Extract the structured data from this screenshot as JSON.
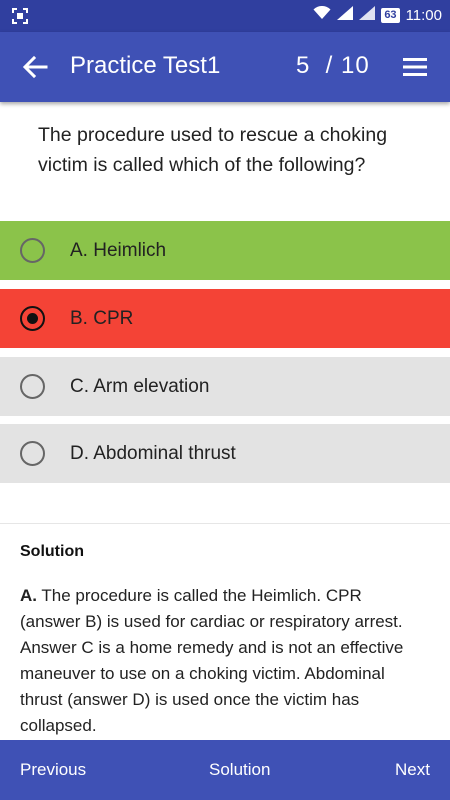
{
  "status_bar": {
    "battery": "63",
    "time": "11:00",
    "icons": [
      "screenshot-icon",
      "wifi-icon",
      "signal-icon",
      "battery-icon"
    ]
  },
  "app_bar": {
    "title": "Practice Test1",
    "progress": "5  / 10",
    "back_icon": "arrow-back-icon",
    "menu_icon": "menu-icon"
  },
  "question": "The procedure used to rescue a choking victim is called which of the following?",
  "options": [
    {
      "label": "A. Heimlich",
      "state": "correct",
      "color": "#8bc34a"
    },
    {
      "label": "B. CPR",
      "state": "selected-wrong",
      "color": "#f44336"
    },
    {
      "label": "C. Arm elevation",
      "state": "neutral",
      "color": "#e3e3e3"
    },
    {
      "label": "D. Abdominal thrust",
      "state": "neutral",
      "color": "#e3e3e3"
    }
  ],
  "solution": {
    "heading": "Solution",
    "answer_letter": "A.",
    "text": " The procedure is called the Heimlich. CPR (answer B) is used for cardiac or respiratory arrest. Answer C is a home remedy and is not an effective maneuver to use on a choking victim. Abdominal thrust (answer D) is used once the victim has collapsed."
  },
  "bottom_nav": {
    "previous": "Previous",
    "solution": "Solution",
    "next": "Next"
  },
  "colors": {
    "app_bar": "#3f51b5",
    "status_bar": "#303f9f"
  }
}
